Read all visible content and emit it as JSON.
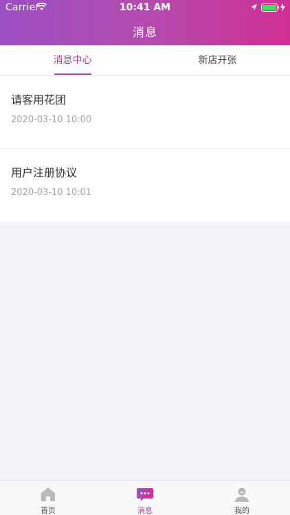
{
  "status_bar": {
    "carrier": "Carrier",
    "time": "10:41 AM"
  },
  "nav": {
    "title": "消息"
  },
  "tabs": [
    {
      "label": "消息中心",
      "active": true
    },
    {
      "label": "新店开张",
      "active": false
    }
  ],
  "messages": [
    {
      "title": "请客用花团",
      "time": "2020-03-10 10:00"
    },
    {
      "title": "用户注册协议",
      "time": "2020-03-10 10:01"
    }
  ],
  "tabbar": [
    {
      "label": "首页",
      "icon": "home-icon",
      "active": false
    },
    {
      "label": "消息",
      "icon": "message-icon",
      "active": true
    },
    {
      "label": "我的",
      "icon": "profile-icon",
      "active": false
    }
  ],
  "colors": {
    "accent": "#b03fa8",
    "header_start": "#9b4fc4",
    "header_end": "#cf2f92"
  }
}
